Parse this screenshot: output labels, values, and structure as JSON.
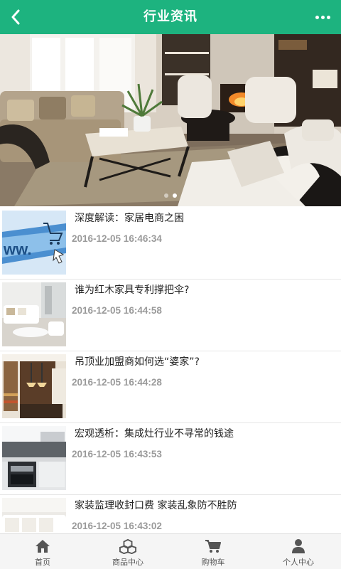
{
  "header": {
    "title": "行业资讯",
    "back_icon": "chevron-left-icon",
    "more_icon": "more-horizontal-icon",
    "background": "#1db37f"
  },
  "banner": {
    "alt": "living-room-banner",
    "slides": 2,
    "active_slide": 2
  },
  "news": [
    {
      "title": "深度解读：家居电商之困",
      "time": "2016-12-05 16:46:34",
      "thumb": "ecommerce-cart-thumbnail"
    },
    {
      "title": "谁为红木家具专利撑把伞?",
      "time": "2016-12-05 16:44:58",
      "thumb": "white-living-room-thumbnail"
    },
    {
      "title": "吊顶业加盟商如何选“婆家”?",
      "time": "2016-12-05 16:44:28",
      "thumb": "wood-interior-thumbnail"
    },
    {
      "title": "宏观透析：集成灶行业不寻常的钱途",
      "time": "2016-12-05 16:43:53",
      "thumb": "kitchen-stove-thumbnail"
    },
    {
      "title": "家装监理收封口费 家装乱象防不胜防",
      "time": "2016-12-05 16:43:02",
      "thumb": "white-sofa-thumbnail"
    }
  ],
  "tabbar": [
    {
      "label": "首页",
      "icon": "home-icon"
    },
    {
      "label": "商品中心",
      "icon": "cubes-icon"
    },
    {
      "label": "购物车",
      "icon": "cart-icon"
    },
    {
      "label": "个人中心",
      "icon": "user-icon"
    }
  ]
}
